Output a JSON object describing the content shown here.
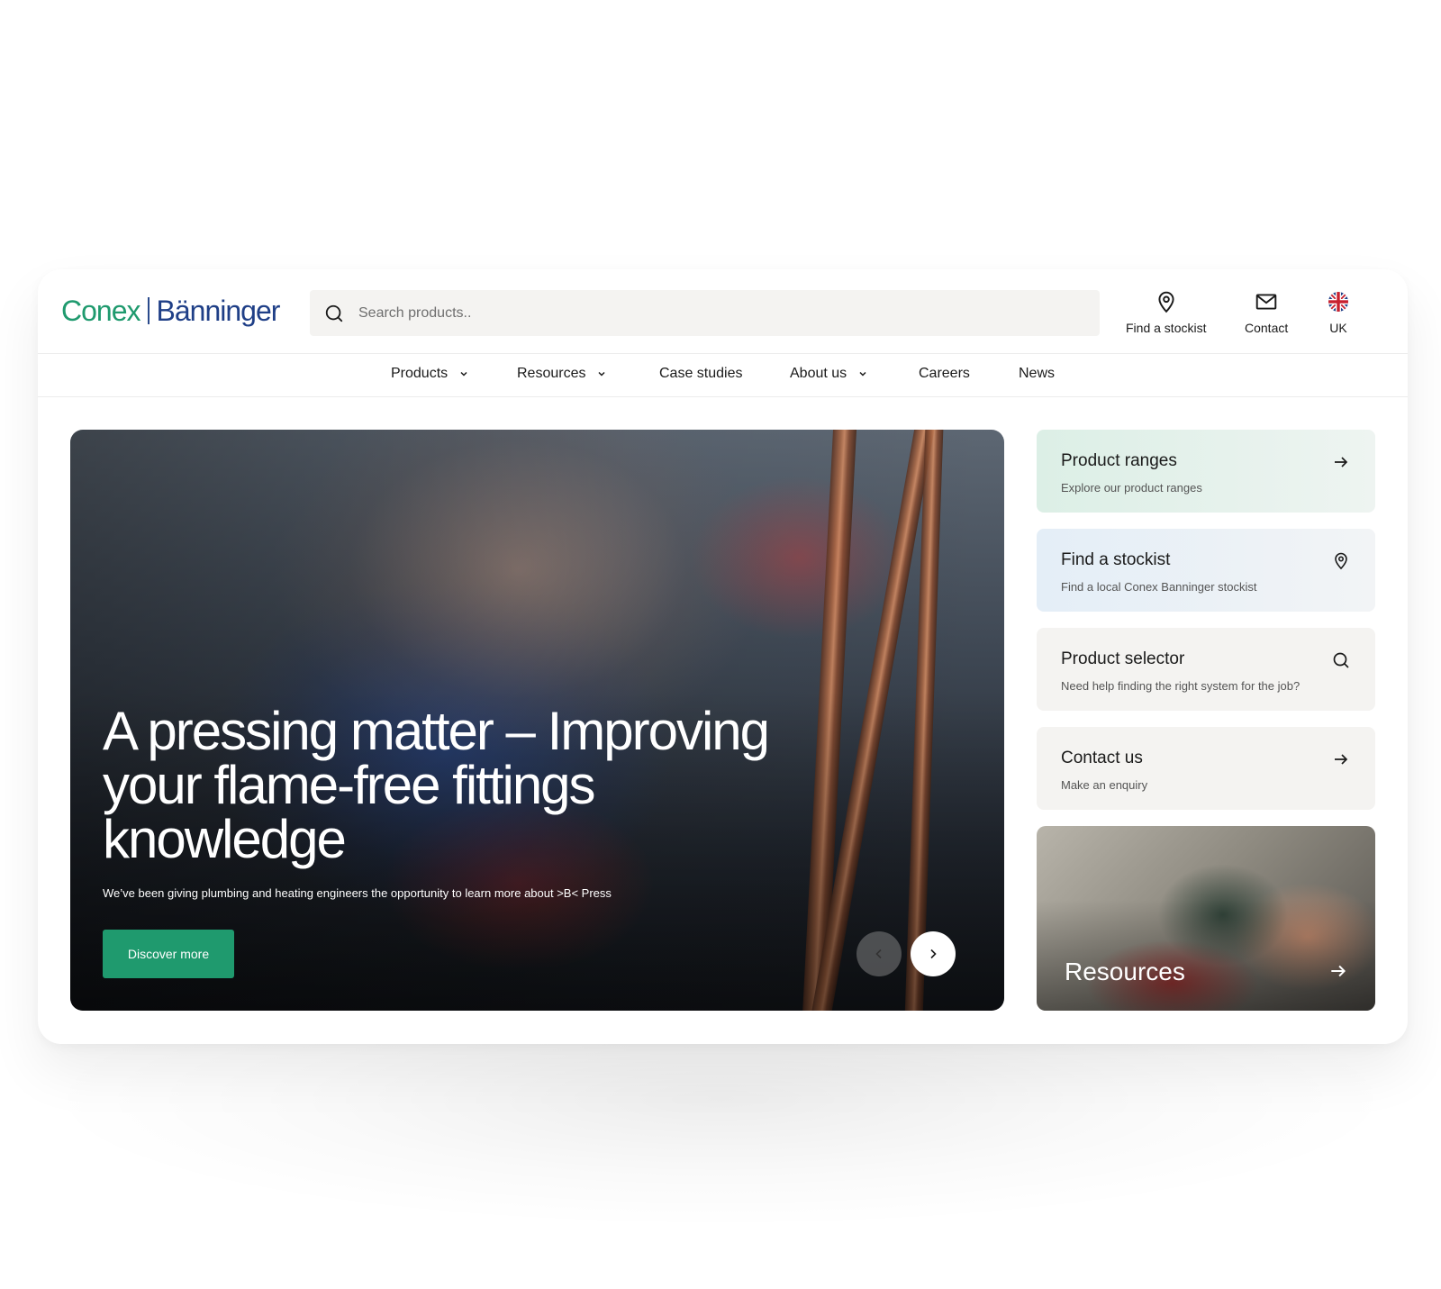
{
  "brand": {
    "name_left": "Conex",
    "name_right": "Bänninger"
  },
  "search": {
    "placeholder": "Search products.."
  },
  "utility": [
    {
      "label": "Find a stockist",
      "icon": "map-pin-icon"
    },
    {
      "label": "Contact",
      "icon": "mail-icon"
    },
    {
      "label": "UK",
      "icon": "uk-flag-icon"
    }
  ],
  "nav": [
    {
      "label": "Products",
      "dropdown": true
    },
    {
      "label": "Resources",
      "dropdown": true
    },
    {
      "label": "Case studies",
      "dropdown": false
    },
    {
      "label": "About us",
      "dropdown": true
    },
    {
      "label": "Careers",
      "dropdown": false
    },
    {
      "label": "News",
      "dropdown": false
    }
  ],
  "hero": {
    "title": "A pressing matter – Improving your flame-free fittings knowledge",
    "subtitle": "We’ve been giving plumbing and heating engineers the opportunity to learn more about >B< Press",
    "cta": "Discover more"
  },
  "cards": [
    {
      "title": "Product ranges",
      "description": "Explore our product ranges",
      "icon": "arrow-right-icon"
    },
    {
      "title": "Find a stockist",
      "description": "Find a local Conex Banninger stockist",
      "icon": "map-pin-icon"
    },
    {
      "title": "Product selector",
      "description": "Need help finding the right system for the job?",
      "icon": "search-icon"
    },
    {
      "title": "Contact us",
      "description": "Make an enquiry",
      "icon": "arrow-right-icon"
    }
  ],
  "resources_card": {
    "title": "Resources",
    "icon": "arrow-right-icon"
  },
  "colors": {
    "brand_green": "#1f9a6e",
    "brand_blue": "#1f3f87"
  }
}
